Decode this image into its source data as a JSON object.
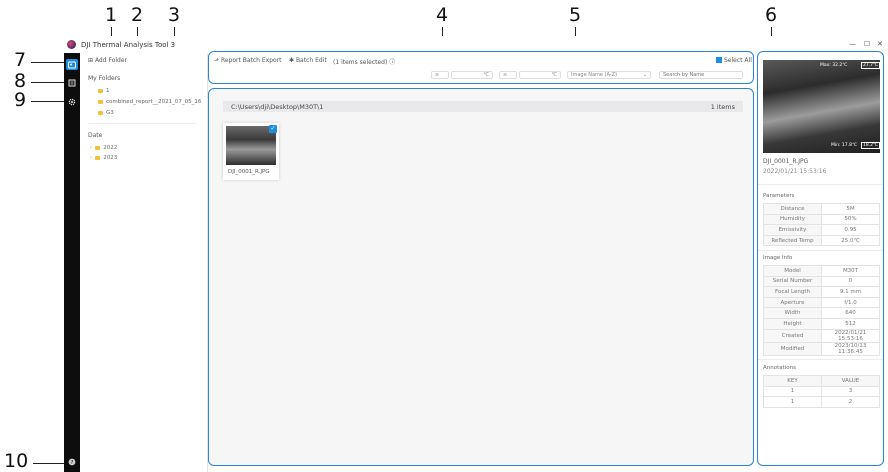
{
  "callouts": [
    "1",
    "2",
    "3",
    "4",
    "5",
    "6",
    "7",
    "8",
    "9",
    "10"
  ],
  "app": {
    "title": "DJI Thermal Analysis Tool 3"
  },
  "folders": {
    "add_label": "Add Folder",
    "my_folders_label": "My Folders",
    "items": [
      "1",
      "combined_report__2021_07_05_16",
      "G3"
    ],
    "date_label": "Date",
    "dates": [
      "2022",
      "2023"
    ]
  },
  "toolbar": {
    "report_label": "Report Batch Export",
    "batch_label": "Batch Edit",
    "selected_label": "(1 items selected)",
    "select_all_label": "Select All",
    "op1": "≥",
    "unit1": "℃",
    "op2": "≤",
    "unit2": "℃",
    "sort_value": "Image Name (A-Z)",
    "search_placeholder": "Search by Name"
  },
  "gallery": {
    "path": "C:\\Users\\dji\\Desktop\\M30T\\1",
    "count": "1 items",
    "thumb_name": "DJI_0001_R.JPG"
  },
  "detail": {
    "max_label": "Max: 32.2℃",
    "max_box": "27.7℃",
    "min_label": "Min: 17.8℃",
    "min_box": "18.2℃",
    "filename": "DJI_0001_R.JPG",
    "datetime": "2022/01/21 15:53:16",
    "params_label": "Parameters",
    "params": [
      {
        "k": "Distance",
        "v": "5M"
      },
      {
        "k": "Humidity",
        "v": "50%"
      },
      {
        "k": "Emissivity",
        "v": "0.95"
      },
      {
        "k": "Reflected Temp",
        "v": "25.0℃"
      }
    ],
    "info_label": "Image Info",
    "info": [
      {
        "k": "Model",
        "v": "M30T"
      },
      {
        "k": "Serial Number",
        "v": "0"
      },
      {
        "k": "Focal Length",
        "v": "9.1 mm"
      },
      {
        "k": "Aperture",
        "v": "f/1.0"
      },
      {
        "k": "Width",
        "v": "640"
      },
      {
        "k": "Height",
        "v": "512"
      },
      {
        "k": "Created",
        "v": "2022/01/21 15:53:16"
      },
      {
        "k": "Modified",
        "v": "2023/10/13 11:36:45"
      }
    ],
    "ann_label": "Annotations",
    "ann_header": {
      "k": "KEY",
      "v": "VALUE"
    },
    "ann": [
      {
        "k": "1",
        "v": "3"
      },
      {
        "k": "1",
        "v": "2"
      }
    ]
  },
  "colors": {
    "accent": "#2a85d6",
    "sidebar": "#0d0d0d",
    "folder": "#f1c232"
  }
}
